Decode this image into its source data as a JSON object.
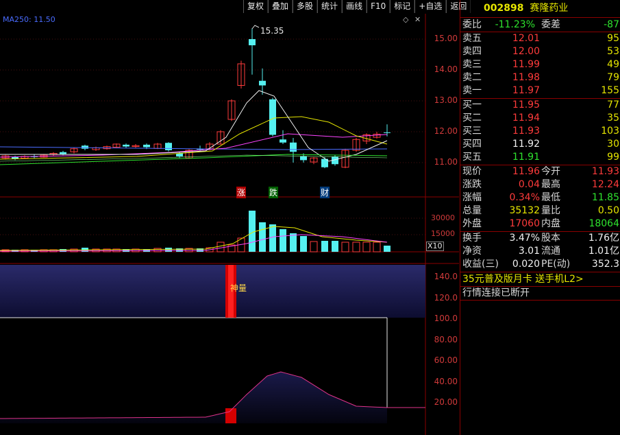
{
  "toolbar": {
    "items": [
      "复权",
      "叠加",
      "多股",
      "统计",
      "画线",
      "F10",
      "标记",
      "+自选",
      "返回"
    ]
  },
  "main_chart": {
    "ma_label": "MA250: 11.50",
    "price_axis": [
      "15.00",
      "14.00",
      "13.00",
      "12.00",
      "11.00"
    ],
    "high_marker": "15.35",
    "signals": {
      "zhang": "涨",
      "die": "跌",
      "cai": "财"
    }
  },
  "volume_chart": {
    "axis": [
      "30000",
      "15000"
    ],
    "unit": "X10"
  },
  "indicator_chart": {
    "axis": [
      "140.0",
      "120.0",
      "100.0",
      "80.00",
      "60.00",
      "40.00",
      "20.00"
    ],
    "label": "神量"
  },
  "quote_panel": {
    "code": "002898",
    "name": "赛隆药业",
    "weibi_label": "委比",
    "weibi_value": "-11.23%",
    "weicha_label": "委差",
    "weicha_value": "-87",
    "asks": [
      {
        "label": "卖五",
        "price": "12.01",
        "vol": "95"
      },
      {
        "label": "卖四",
        "price": "12.00",
        "vol": "53"
      },
      {
        "label": "卖三",
        "price": "11.99",
        "vol": "49"
      },
      {
        "label": "卖二",
        "price": "11.98",
        "vol": "79"
      },
      {
        "label": "卖一",
        "price": "11.97",
        "vol": "155"
      }
    ],
    "bids": [
      {
        "label": "买一",
        "price": "11.95",
        "vol": "77"
      },
      {
        "label": "买二",
        "price": "11.94",
        "vol": "35"
      },
      {
        "label": "买三",
        "price": "11.93",
        "vol": "103"
      },
      {
        "label": "买四",
        "price": "11.92",
        "vol": "30"
      },
      {
        "label": "买五",
        "price": "11.91",
        "vol": "99"
      }
    ],
    "stats": [
      {
        "l": "现价",
        "v": "11.96",
        "l2": "今开",
        "v2": "11.93"
      },
      {
        "l": "涨跌",
        "v": "0.04",
        "l2": "最高",
        "v2": "12.24"
      },
      {
        "l": "涨幅",
        "v": "0.34%",
        "l2": "最低",
        "v2": "11.85"
      },
      {
        "l": "总量",
        "v": "35132",
        "l2": "量比",
        "v2": "0.50"
      },
      {
        "l": "外盘",
        "v": "17060",
        "l2": "内盘",
        "v2": "18064"
      }
    ],
    "stats2": [
      {
        "l": "换手",
        "v": "3.47%",
        "l2": "股本",
        "v2": "1.76亿"
      },
      {
        "l": "净资",
        "v": "3.01",
        "l2": "流通",
        "v2": "1.01亿"
      },
      {
        "l": "收益(三)",
        "v": "0.020",
        "l2": "PE(动)",
        "v2": "352.3"
      }
    ],
    "promo": "35元普及版月卡 送手机L2>",
    "status": "行情连接已断开"
  },
  "colors": {
    "up": "#ff3b3b",
    "down": "#55f0f0",
    "grid": "#8b0000",
    "accent": "#e6e600"
  }
}
